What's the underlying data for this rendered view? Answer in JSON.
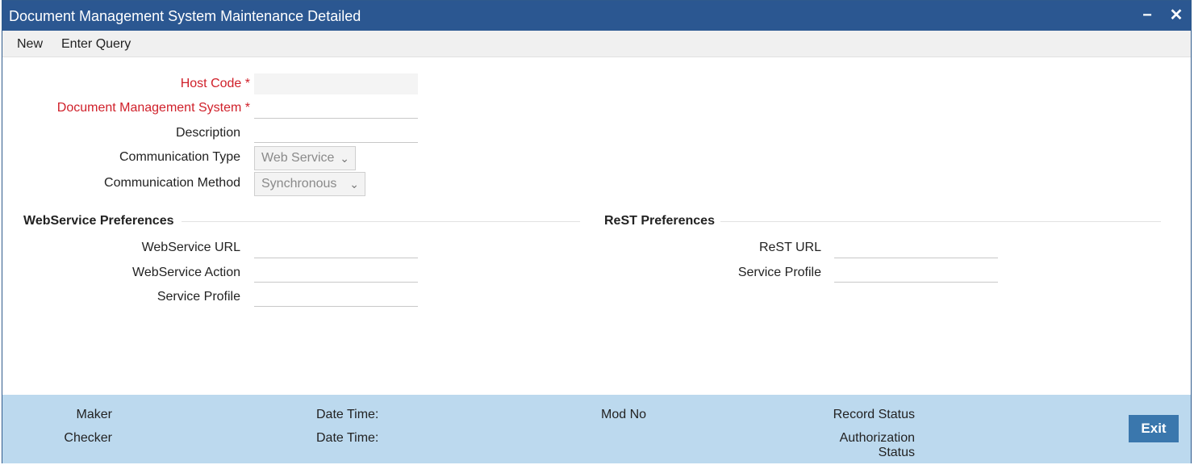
{
  "window": {
    "title": "Document Management System Maintenance Detailed",
    "minimize_glyph": "−",
    "close_glyph": "✕"
  },
  "menu": {
    "new": "New",
    "enter_query": "Enter Query"
  },
  "form": {
    "host_code": {
      "label": "Host Code",
      "required": "*",
      "value": ""
    },
    "dms": {
      "label": "Document Management System",
      "required": "*",
      "value": ""
    },
    "description": {
      "label": "Description",
      "value": ""
    },
    "communication_type": {
      "label": "Communication Type",
      "selected": "Web Service"
    },
    "communication_method": {
      "label": "Communication Method",
      "selected": "Synchronous"
    }
  },
  "webservice": {
    "title": "WebService Preferences",
    "url_label": "WebService URL",
    "action_label": "WebService Action",
    "profile_label": "Service Profile"
  },
  "rest": {
    "title": "ReST Preferences",
    "url_label": "ReST URL",
    "profile_label": "Service Profile"
  },
  "footer": {
    "maker": "Maker",
    "checker": "Checker",
    "date_time_1": "Date Time:",
    "date_time_2": "Date Time:",
    "mod_no": "Mod No",
    "record_status": "Record Status",
    "authorization_status_line1": "Authorization",
    "authorization_status_line2": "Status",
    "exit": "Exit"
  },
  "colors": {
    "titlebar": "#2b5791",
    "required": "#d0202a",
    "footer": "#bcd9ee",
    "exit_button": "#3a77ad"
  }
}
